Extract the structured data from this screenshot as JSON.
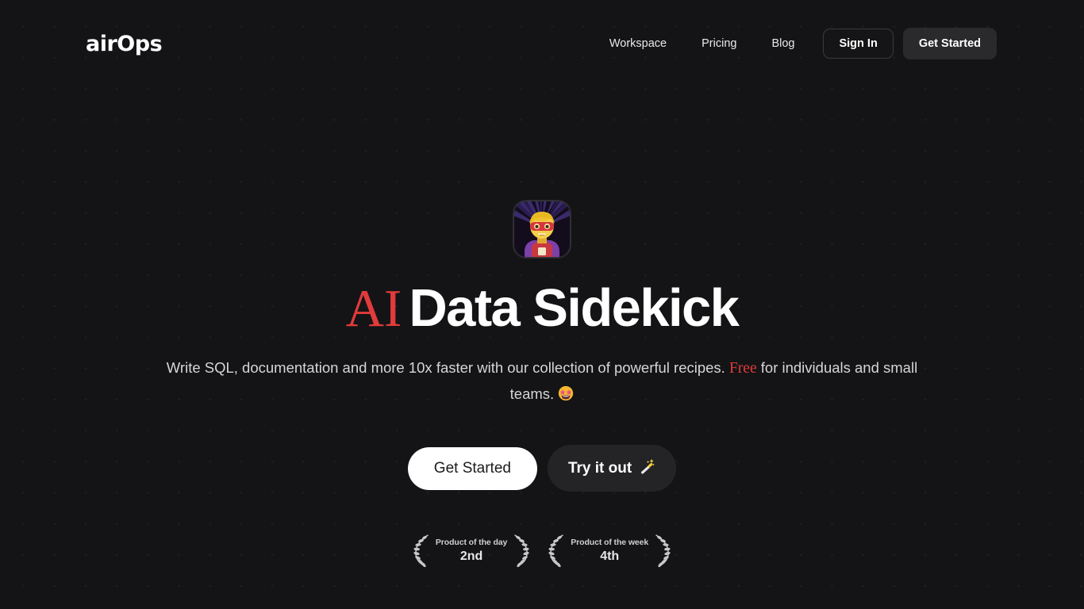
{
  "header": {
    "brand": {
      "text_a": "air",
      "text_o": "O",
      "text_b": "ps",
      "full": "airOps"
    },
    "nav_links": [
      {
        "label": "Workspace",
        "name": "nav-link-workspace"
      },
      {
        "label": "Pricing",
        "name": "nav-link-pricing"
      },
      {
        "label": "Blog",
        "name": "nav-link-blog"
      }
    ],
    "sign_in_label": "Sign In",
    "get_started_label": "Get Started"
  },
  "hero": {
    "icon_name": "superhero-emoji-icon",
    "icon_emoji": "🦸",
    "title_accent": "AI",
    "title_main": "Data Sidekick",
    "subtitle_part_1": "Write SQL, documentation and more 10x faster with our collection of powerful recipes. ",
    "subtitle_accent": "Free",
    "subtitle_part_2": " for individuals and small teams. ",
    "subtitle_emoji": "🤩",
    "cta_primary_label": "Get Started",
    "cta_secondary_label": "Try it out",
    "cta_secondary_emoji": "🪄"
  },
  "badges": [
    {
      "title": "Product of the day",
      "rank": "2nd"
    },
    {
      "title": "Product of the week",
      "rank": "4th"
    }
  ],
  "colors": {
    "background": "#141416",
    "accent_red": "#e23b3b",
    "text_primary": "#ffffff",
    "text_secondary": "#d6d6d8",
    "button_dark": "#2a2a2d"
  }
}
